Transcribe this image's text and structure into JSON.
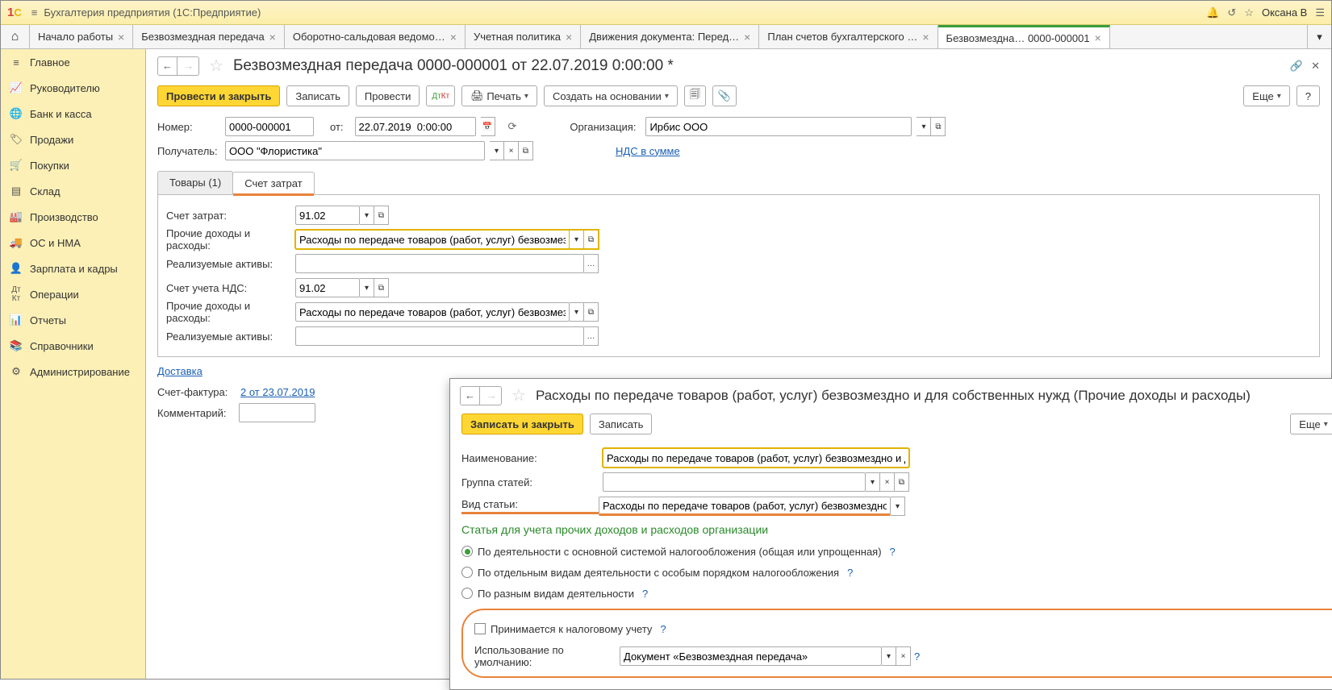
{
  "titlebar": {
    "app": "Бухгалтерия предприятия  (1С:Предприятие)",
    "user": "Оксана В"
  },
  "tabs": [
    "Начало работы",
    "Безвозмездная передача",
    "Оборотно-сальдовая ведомо…",
    "Учетная политика",
    "Движения документа: Перед…",
    "План счетов бухгалтерского …",
    "Безвозмездна…      0000-000001"
  ],
  "sidebar": [
    {
      "icon": "≡",
      "label": "Главное"
    },
    {
      "icon": "📈",
      "label": "Руководителю"
    },
    {
      "icon": "🌐",
      "label": "Банк и касса"
    },
    {
      "icon": "🏷",
      "label": "Продажи"
    },
    {
      "icon": "🛒",
      "label": "Покупки"
    },
    {
      "icon": "▤",
      "label": "Склад"
    },
    {
      "icon": "🏭",
      "label": "Производство"
    },
    {
      "icon": "🚚",
      "label": "ОС и НМА"
    },
    {
      "icon": "👤",
      "label": "Зарплата и кадры"
    },
    {
      "icon": "ᴬᵀ",
      "label": "Операции"
    },
    {
      "icon": "📊",
      "label": "Отчеты"
    },
    {
      "icon": "📚",
      "label": "Справочники"
    },
    {
      "icon": "⚙",
      "label": "Администрирование"
    }
  ],
  "doc": {
    "title": "Безвозмездная передача 0000-000001 от 22.07.2019 0:00:00 *",
    "btn_post_close": "Провести и закрыть",
    "btn_save": "Записать",
    "btn_post": "Провести",
    "btn_print": "Печать",
    "btn_baseon": "Создать на основании",
    "btn_more": "Еще",
    "lbl_number": "Номер:",
    "number": "0000-000001",
    "lbl_from": "от:",
    "date": "22.07.2019  0:00:00",
    "lbl_org": "Организация:",
    "org": "Ирбис ООО",
    "lbl_recipient": "Получатель:",
    "recipient": "ООО \"Флористика\"",
    "vat_link": "НДС в сумме",
    "tab_goods": "Товары (1)",
    "tab_costs": "Счет затрат",
    "costs": {
      "account_lbl": "Счет затрат:",
      "account": "91.02",
      "other_lbl": "Прочие доходы и расходы:",
      "other_val": "Расходы по передаче товаров (работ, услуг) безвозмездно",
      "assets_lbl": "Реализуемые активы:",
      "vat_acc_lbl": "Счет учета НДС:",
      "vat_acc": "91.02",
      "other2_lbl": "Прочие доходы и расходы:",
      "other2_val": "Расходы по передаче товаров (работ, услуг) безвозмездно",
      "assets2_lbl": "Реализуемые активы:"
    },
    "delivery": "Доставка",
    "invoice_lbl": "Счет-фактура:",
    "invoice_link": "2 от 23.07.2019",
    "comment_lbl": "Комментарий:"
  },
  "dialog": {
    "title": "Расходы по передаче товаров (работ, услуг) безвозмездно и для собственных нужд (Прочие доходы и расходы)",
    "btn_save_close": "Записать и закрыть",
    "btn_save": "Записать",
    "btn_more": "Еще",
    "name_lbl": "Наименование:",
    "name_val": "Расходы по передаче товаров (работ, услуг) безвозмездно и для",
    "group_lbl": "Группа статей:",
    "type_lbl": "Вид статьи:",
    "type_val": "Расходы по передаче товаров (работ, услуг) безвозмездно и .",
    "section_h": "Статья для учета прочих доходов и расходов организации",
    "radio1": "По деятельности с основной системой налогообложения (общая или упрощенная)",
    "radio2": "По отдельным видам деятельности с особым порядком налогообложения",
    "radio3": "По разным видам деятельности",
    "tax_chk": "Принимается к налоговому учету",
    "default_lbl": "Использование по умолчанию:",
    "default_val": "Документ «Безвозмездная передача»"
  }
}
